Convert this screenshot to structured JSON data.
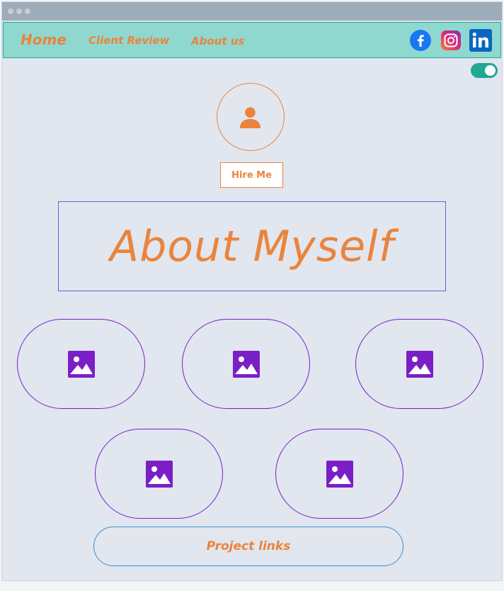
{
  "nav": {
    "home": "Home",
    "client_review": "Client Review",
    "about_us": "About us"
  },
  "social": [
    "facebook-icon",
    "instagram-icon",
    "linkedin-icon"
  ],
  "theme_toggle": {
    "on": true
  },
  "hero": {
    "hire_label": "Hire Me",
    "about_title": "About Myself"
  },
  "gallery": {
    "items": [
      "image-icon",
      "image-icon",
      "image-icon",
      "image-icon",
      "image-icon"
    ]
  },
  "project_links_label": "Project links",
  "colors": {
    "accent_orange": "#ea843c",
    "nav_bg": "#8fd8d0",
    "teal": "#1fa894",
    "purple": "#7a1fc8",
    "page_bg": "#e1e6ef"
  }
}
